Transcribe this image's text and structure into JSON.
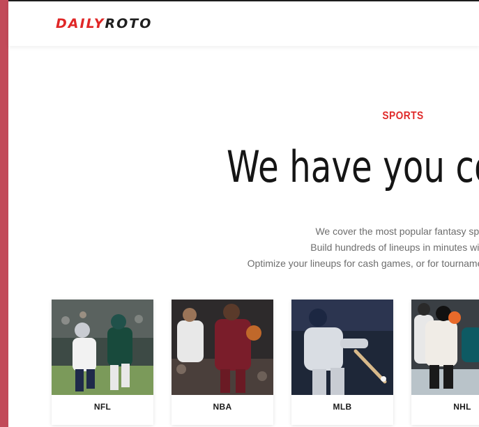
{
  "header": {
    "logo_part1": "DAILY",
    "logo_part2": "ROTO"
  },
  "hero": {
    "eyebrow": "SPORTS",
    "headline": "We have you co",
    "description_lines": [
      "We cover the most popular fantasy sport",
      "Build hundreds of lineups in minutes with o",
      "Optimize your lineups for cash games, or for tournaments, by toggling st"
    ]
  },
  "sports": [
    {
      "label": "NFL"
    },
    {
      "label": "NBA"
    },
    {
      "label": "MLB"
    },
    {
      "label": "NHL"
    }
  ],
  "colors": {
    "accent": "#e02b2b",
    "side_bar": "#c24a59",
    "text_dark": "#151515",
    "text_muted": "#6d6d6d"
  }
}
